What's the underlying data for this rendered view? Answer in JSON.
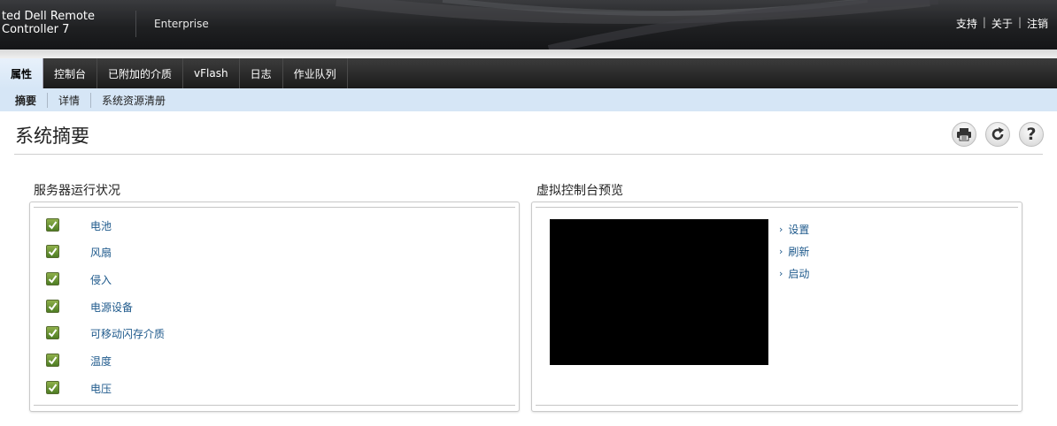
{
  "header": {
    "brand_line1": "ted Dell Remote",
    "brand_line2": "Controller 7",
    "edition": "Enterprise",
    "links": [
      "支持",
      "关于",
      "注销"
    ]
  },
  "tabs": [
    {
      "label": "属性",
      "active": true
    },
    {
      "label": "控制台",
      "active": false
    },
    {
      "label": "已附加的介质",
      "active": false
    },
    {
      "label": "vFlash",
      "active": false
    },
    {
      "label": "日志",
      "active": false
    },
    {
      "label": "作业队列",
      "active": false
    }
  ],
  "subtabs": [
    {
      "label": "摘要",
      "active": true
    },
    {
      "label": "详情",
      "active": false
    },
    {
      "label": "系统资源清册",
      "active": false
    }
  ],
  "page": {
    "title": "系统摘要",
    "tool_icons": [
      "print-icon",
      "refresh-icon",
      "help-icon"
    ]
  },
  "health": {
    "title": "服务器运行状况",
    "items": [
      "电池",
      "风扇",
      "侵入",
      "电源设备",
      "可移动闪存介质",
      "温度",
      "电压"
    ]
  },
  "console_preview": {
    "title": "虚拟控制台预览",
    "links": [
      "设置",
      "刷新",
      "启动"
    ]
  },
  "colors": {
    "link": "#1f5a8c",
    "subnav_bg": "#d6e6f6",
    "status_ok": "#4e7d23"
  }
}
